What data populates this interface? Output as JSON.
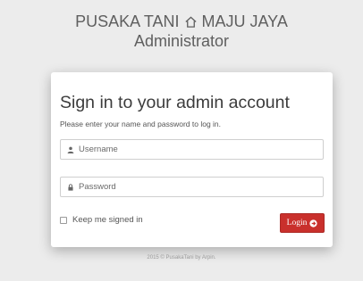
{
  "header": {
    "brand_left": "PUSAKA TANI",
    "brand_icon": "home-icon",
    "brand_right": "MAJU JAYA",
    "subtitle": "Administrator"
  },
  "panel": {
    "title": "Sign in to your admin account",
    "subtitle": "Please enter your name and password to log in.",
    "username": {
      "placeholder": "Username",
      "icon": "user-icon"
    },
    "password": {
      "placeholder": "Password",
      "icon": "lock-icon"
    },
    "remember_label": "Keep me signed in",
    "login_label": "Login",
    "login_icon": "arrow-circle-right-icon",
    "accent_color": "#c9302c"
  },
  "footer": {
    "text": "2015 © PusakaTani by Arpin."
  }
}
